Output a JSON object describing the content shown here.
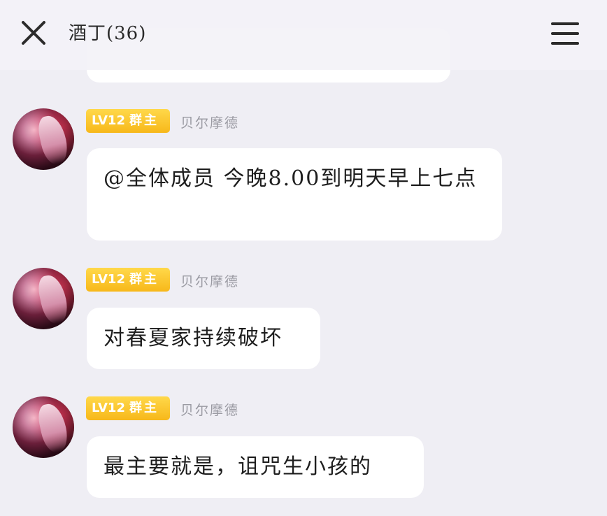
{
  "header": {
    "title": "酒丁(36)",
    "close_icon": "close-icon",
    "menu_icon": "hamburger-menu-icon"
  },
  "messages": [
    {
      "level": "LV12",
      "role": "群主",
      "username": "贝尔摩德",
      "text": "@全体成员 今晚8.00到明天早上七点"
    },
    {
      "level": "LV12",
      "role": "群主",
      "username": "贝尔摩德",
      "text": "对春夏家持续破坏"
    },
    {
      "level": "LV12",
      "role": "群主",
      "username": "贝尔摩德",
      "text": "最主要就是，诅咒生小孩的"
    }
  ],
  "colors": {
    "background": "#efeef4",
    "badge": "#f7c22a",
    "bubble": "#ffffff",
    "username": "#9a9aa2"
  }
}
